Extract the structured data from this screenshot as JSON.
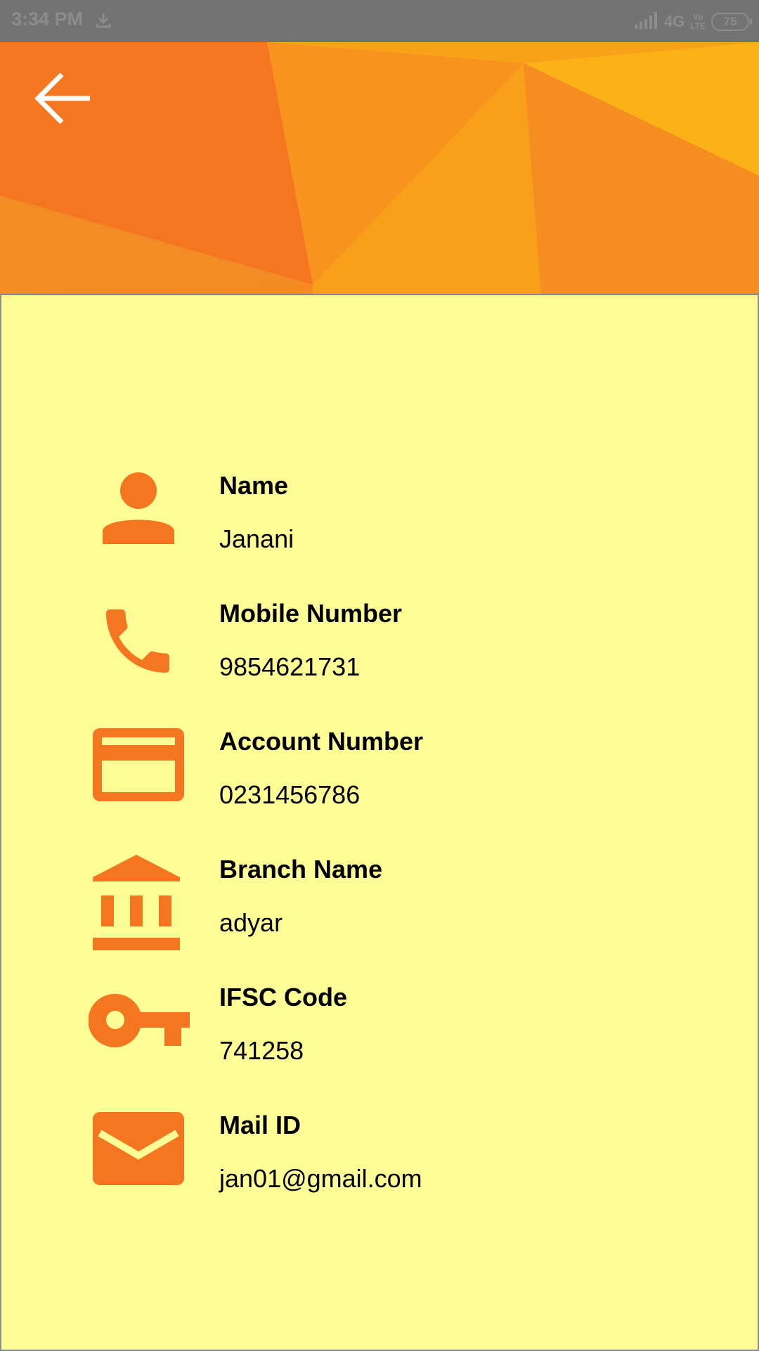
{
  "status_bar": {
    "time": "3:34 PM",
    "network": "4G",
    "volte_top": "Vo",
    "volte_bottom": "LTE",
    "battery": "75",
    "icons": [
      "download-icon",
      "signal-icon",
      "battery-icon"
    ]
  },
  "header": {
    "back_icon": "arrow-left-icon",
    "colors": {
      "orange_dark": "#f47621",
      "orange_mid": "#f7931e",
      "orange_light": "#fbb116"
    }
  },
  "theme": {
    "accent": "#f47621",
    "panel_bg": "#fffe96"
  },
  "profile": {
    "rows": [
      {
        "icon": "person-icon",
        "label": "Name",
        "value": "Janani"
      },
      {
        "icon": "phone-icon",
        "label": "Mobile Number",
        "value": "9854621731"
      },
      {
        "icon": "credit-card-icon",
        "label": "Account Number",
        "value": "0231456786"
      },
      {
        "icon": "bank-icon",
        "label": "Branch Name",
        "value": "adyar"
      },
      {
        "icon": "key-icon",
        "label": "IFSC Code",
        "value": "741258"
      },
      {
        "icon": "mail-icon",
        "label": "Mail ID",
        "value": "jan01@gmail.com"
      }
    ]
  }
}
